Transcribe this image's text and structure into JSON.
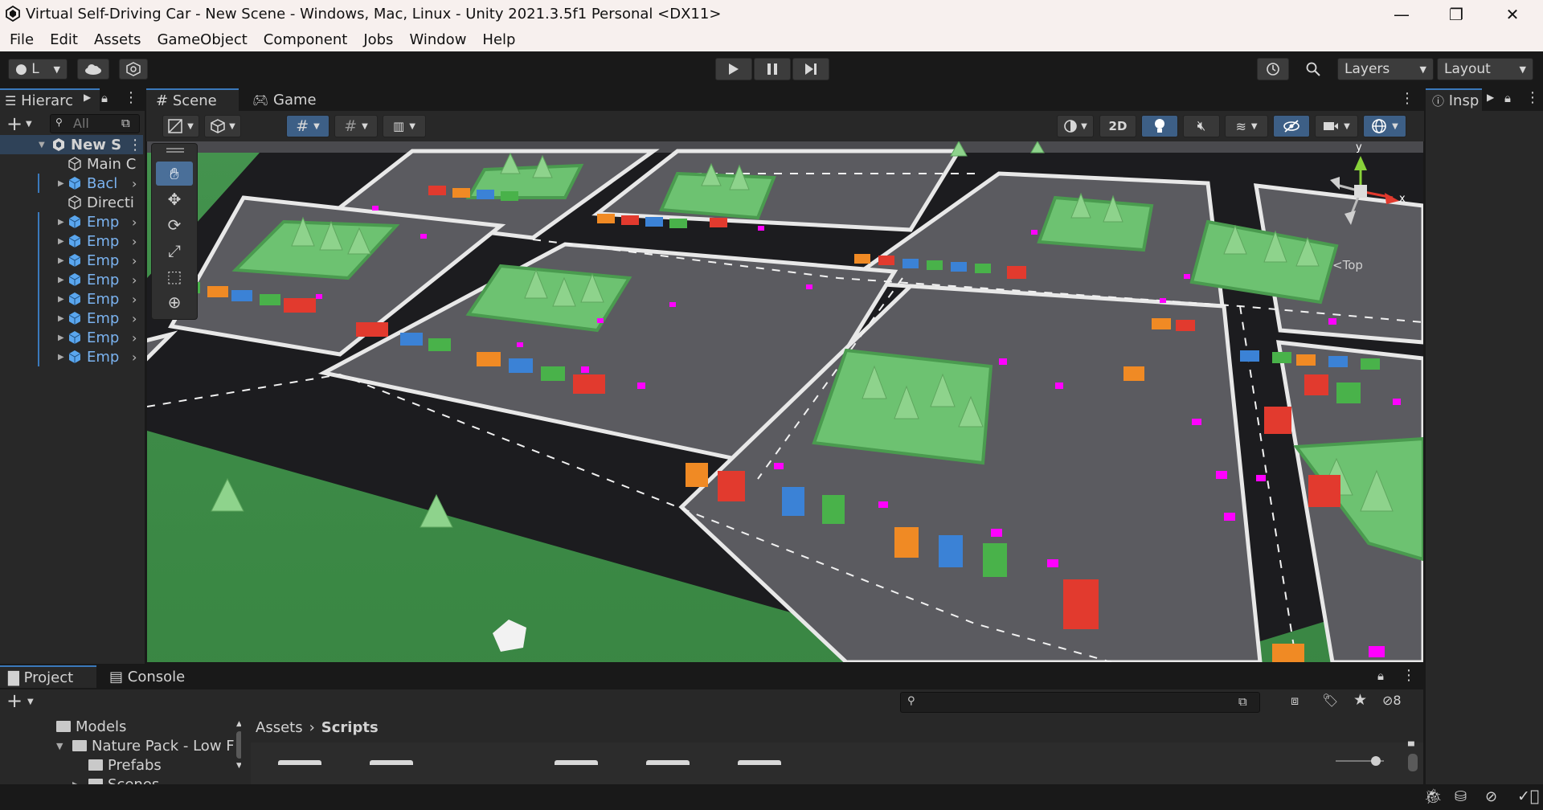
{
  "window": {
    "title": "Virtual Self-Driving Car - New Scene - Windows, Mac, Linux - Unity 2021.3.5f1 Personal <DX11>",
    "minimize": "—",
    "maximize": "❐",
    "close": "✕"
  },
  "menu": [
    "File",
    "Edit",
    "Assets",
    "GameObject",
    "Component",
    "Jobs",
    "Window",
    "Help"
  ],
  "toolbar": {
    "account_label": "L",
    "layers_label": "Layers",
    "layout_label": "Layout"
  },
  "hierarchy": {
    "tab_label": "Hierarc",
    "search_placeholder": "All",
    "scene_name": "New S",
    "items": [
      {
        "label": "Main C",
        "blue": false,
        "expandable": false
      },
      {
        "label": "Bacl",
        "blue": true,
        "expandable": true
      },
      {
        "label": "Directi",
        "blue": false,
        "expandable": false
      },
      {
        "label": "Emp",
        "blue": true,
        "expandable": true
      },
      {
        "label": "Emp",
        "blue": true,
        "expandable": true
      },
      {
        "label": "Emp",
        "blue": true,
        "expandable": true
      },
      {
        "label": "Emp",
        "blue": true,
        "expandable": true
      },
      {
        "label": "Emp",
        "blue": true,
        "expandable": true
      },
      {
        "label": "Emp",
        "blue": true,
        "expandable": true
      },
      {
        "label": "Emp",
        "blue": true,
        "expandable": true
      },
      {
        "label": "Emp",
        "blue": true,
        "expandable": true
      }
    ]
  },
  "scene_tabs": {
    "scene": "Scene",
    "game": "Game"
  },
  "scene_toolbar": {
    "mode_2d": "2D"
  },
  "gizmo": {
    "y_label": "y",
    "x_label": "x",
    "view_label": "Top"
  },
  "inspector": {
    "tab_label": "Insp"
  },
  "project": {
    "tab_project": "Project",
    "tab_console": "Console",
    "tree": [
      {
        "label": "Models",
        "indent": 1,
        "arrow": ""
      },
      {
        "label": "Nature Pack - Low F",
        "indent": 0,
        "arrow": "▼"
      },
      {
        "label": "Prefabs",
        "indent": 2,
        "arrow": ""
      },
      {
        "label": "Scenes",
        "indent": 2,
        "arrow": "▶"
      }
    ],
    "breadcrumb_root": "Assets",
    "breadcrumb_current": "Scripts",
    "hidden_count": "8"
  },
  "colors": {
    "accent": "#3a79bb",
    "grass": "#3b8a45",
    "road": "#1d1d1f",
    "lot": "#5a5a5f",
    "marker": "#ff00ff"
  }
}
